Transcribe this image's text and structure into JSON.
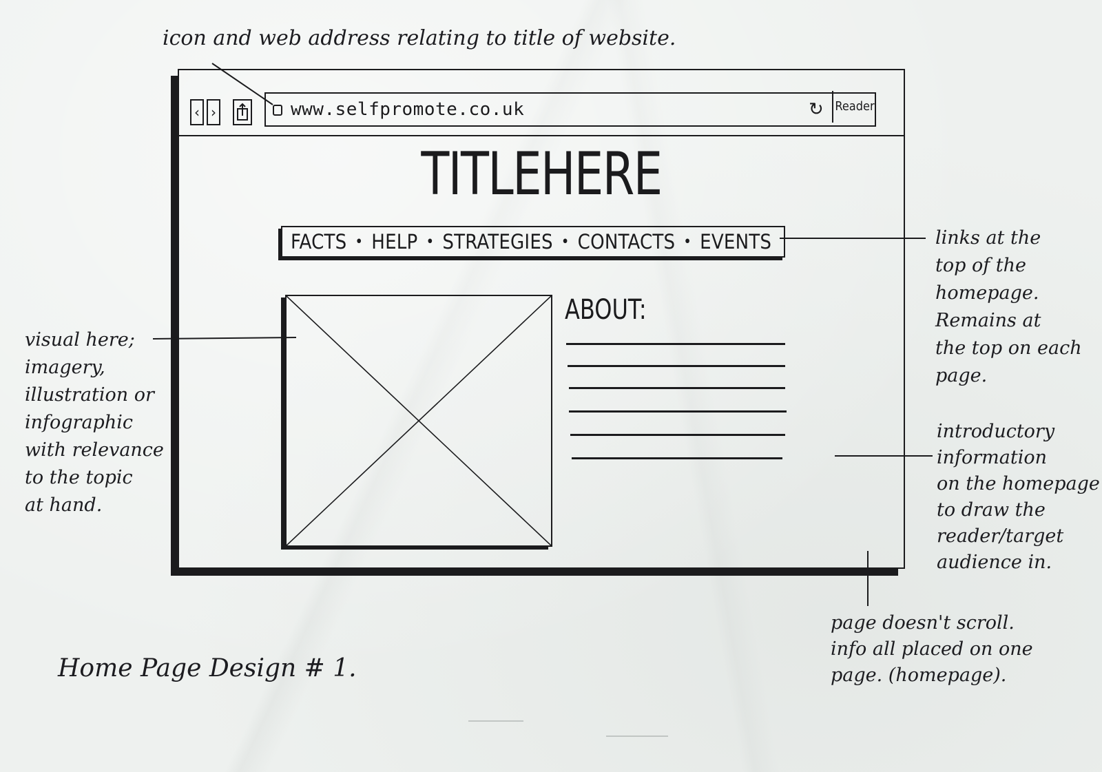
{
  "annotations": {
    "top": "icon and web address relating to title of website.",
    "left": "visual here;\nimagery,\nillustration or\ninfographic\nwith relevance\nto the topic\nat hand.",
    "right_top": "links at the\ntop of the\nhomepage.\nRemains at\nthe top on each\npage.",
    "right_mid": "introductory\ninformation\non the homepage\nto draw the\nreader/target\naudience in.",
    "bottom": "page doesn't scroll.\ninfo all placed on one\npage. (homepage)."
  },
  "browser": {
    "url": "www.selfpromote.co.uk",
    "reader_label": "Reader",
    "back_icon": "‹",
    "forward_icon": "›",
    "refresh_icon": "↻"
  },
  "page": {
    "title": "TITLEHERE",
    "nav": [
      "FACTS",
      "HELP",
      "STRATEGIES",
      "CONTACTS",
      "EVENTS"
    ],
    "nav_separator": "•",
    "about_heading": "ABOUT:"
  },
  "design_label": "Home Page Design # 1."
}
